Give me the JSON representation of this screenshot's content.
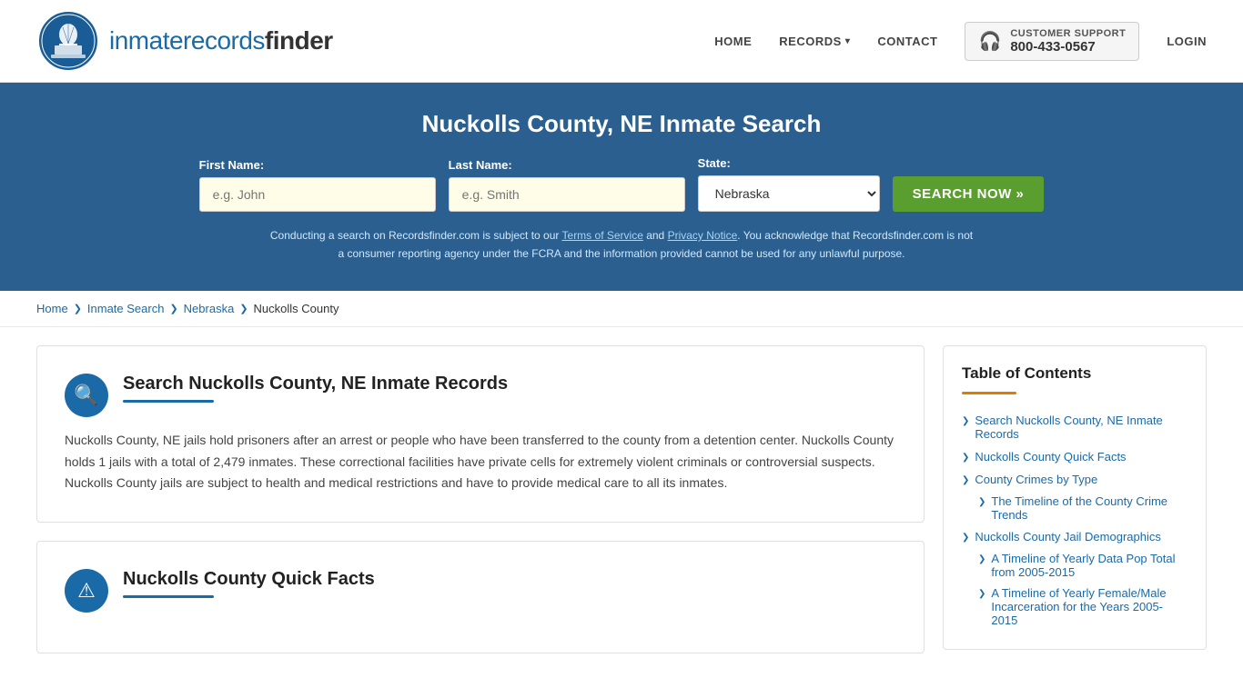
{
  "header": {
    "logo_text_normal": "inmaterecords",
    "logo_text_bold": "finder",
    "nav": {
      "home_label": "HOME",
      "records_label": "RECORDS",
      "contact_label": "CONTACT",
      "support_label": "CUSTOMER SUPPORT",
      "support_number": "800-433-0567",
      "login_label": "LOGIN"
    }
  },
  "hero": {
    "title": "Nuckolls County, NE Inmate Search",
    "form": {
      "first_name_label": "First Name:",
      "first_name_placeholder": "e.g. John",
      "last_name_label": "Last Name:",
      "last_name_placeholder": "e.g. Smith",
      "state_label": "State:",
      "state_value": "Nebraska",
      "search_btn_label": "SEARCH NOW »"
    },
    "disclaimer": "Conducting a search on Recordsfinder.com is subject to our Terms of Service and Privacy Notice. You acknowledge that Recordsfinder.com is not a consumer reporting agency under the FCRA and the information provided cannot be used for any unlawful purpose.",
    "terms_label": "Terms of Service",
    "privacy_label": "Privacy Notice"
  },
  "breadcrumb": {
    "home": "Home",
    "inmate_search": "Inmate Search",
    "nebraska": "Nebraska",
    "current": "Nuckolls County"
  },
  "content_section": {
    "main_card": {
      "title": "Search Nuckolls County, NE Inmate Records",
      "body": "Nuckolls County, NE jails hold prisoners after an arrest or people who have been transferred to the county from a detention center. Nuckolls County holds 1 jails with a total of 2,479 inmates. These correctional facilities have private cells for extremely violent criminals or controversial suspects. Nuckolls County jails are subject to health and medical restrictions and have to provide medical care to all its inmates."
    },
    "quick_facts_card": {
      "title": "Nuckolls County Quick Facts"
    }
  },
  "sidebar": {
    "toc_title": "Table of Contents",
    "items": [
      {
        "label": "Search Nuckolls County, NE Inmate Records",
        "sub": false
      },
      {
        "label": "Nuckolls County Quick Facts",
        "sub": false
      },
      {
        "label": "County Crimes by Type",
        "sub": false
      },
      {
        "label": "The Timeline of the County Crime Trends",
        "sub": true
      },
      {
        "label": "Nuckolls County Jail Demographics",
        "sub": false
      },
      {
        "label": "A Timeline of Yearly Data Pop Total from 2005-2015",
        "sub": true
      },
      {
        "label": "A Timeline of Yearly Female/Male Incarceration for the Years 2005-2015",
        "sub": true
      }
    ]
  }
}
